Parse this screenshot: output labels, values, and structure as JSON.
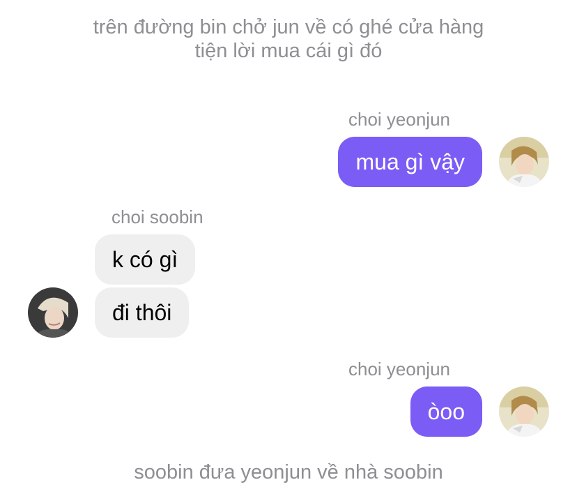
{
  "narration": {
    "top_line1": "trên đường bin chở jun về có ghé cửa hàng",
    "top_line2": "tiện lời mua cái gì đó",
    "bottom": "soobin đưa yeonjun về nhà soobin"
  },
  "groups": [
    {
      "sender": "choi yeonjun",
      "messages": [
        "mua gì vậy"
      ]
    },
    {
      "sender": "choi soobin",
      "messages": [
        "k có gì",
        "đi thôi"
      ]
    },
    {
      "sender": "choi yeonjun",
      "messages": [
        "òoo"
      ]
    }
  ],
  "colors": {
    "outgoing_bubble": "#7b5cf5",
    "incoming_bubble": "#efefef",
    "meta_text": "#8e8e93"
  }
}
